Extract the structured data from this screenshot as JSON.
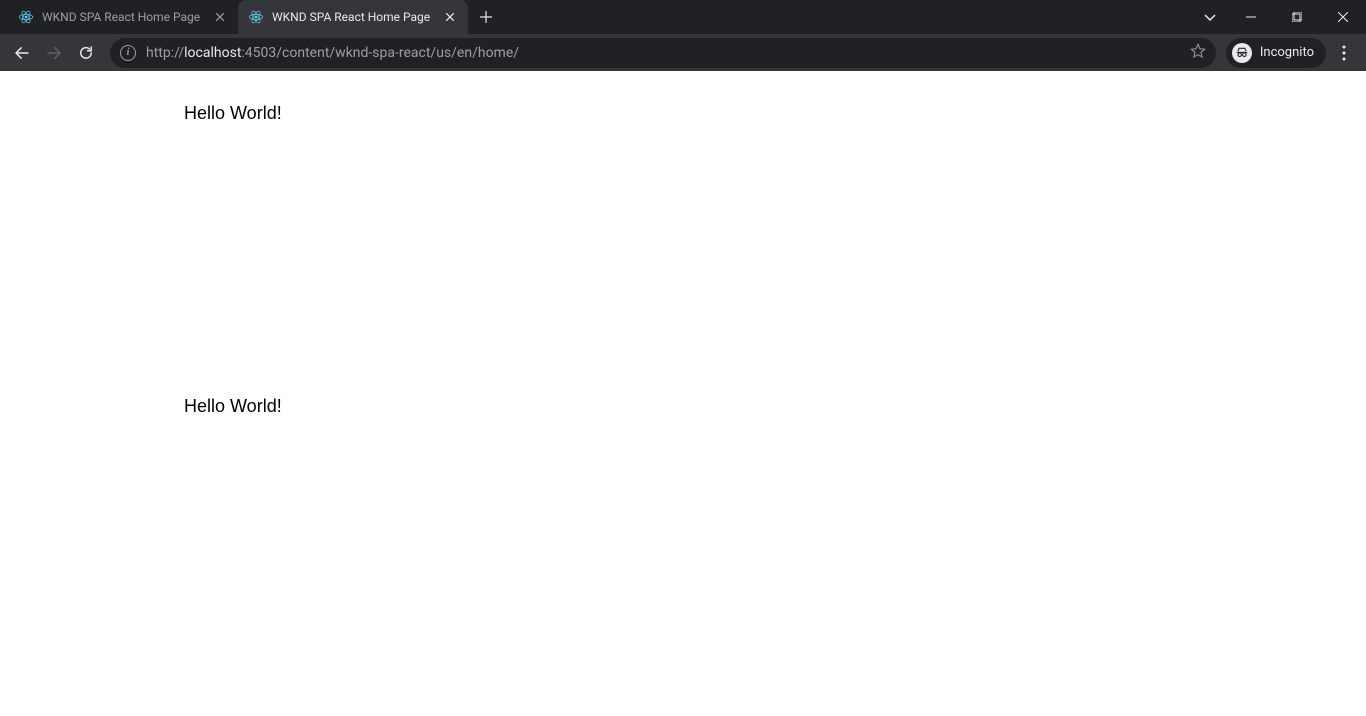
{
  "tabs": [
    {
      "title": "WKND SPA React Home Page",
      "active": false
    },
    {
      "title": "WKND SPA React Home Page",
      "active": true
    }
  ],
  "url": {
    "scheme": "http://",
    "host": "localhost",
    "port_path": ":4503/content/wknd-spa-react/us/en/home/"
  },
  "incognito_label": "Incognito",
  "content": {
    "text1": "Hello World!",
    "text2": "Hello World!"
  }
}
